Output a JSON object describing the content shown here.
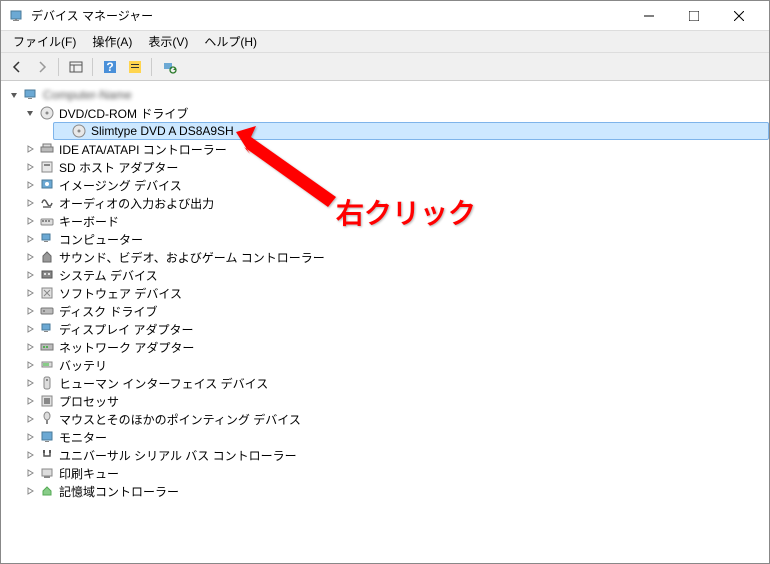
{
  "window": {
    "title": "デバイス マネージャー"
  },
  "menubar": {
    "file": "ファイル(F)",
    "action": "操作(A)",
    "view": "表示(V)",
    "help": "ヘルプ(H)"
  },
  "tree": {
    "root": "Computer-Name",
    "dvd_category": "DVD/CD-ROM ドライブ",
    "dvd_device": "Slimtype DVD A  DS8A9SH",
    "items": [
      "IDE ATA/ATAPI コントローラー",
      "SD ホスト アダプター",
      "イメージング デバイス",
      "オーディオの入力および出力",
      "キーボード",
      "コンピューター",
      "サウンド、ビデオ、およびゲーム コントローラー",
      "システム デバイス",
      "ソフトウェア デバイス",
      "ディスク ドライブ",
      "ディスプレイ アダプター",
      "ネットワーク アダプター",
      "バッテリ",
      "ヒューマン インターフェイス デバイス",
      "プロセッサ",
      "マウスとそのほかのポインティング デバイス",
      "モニター",
      "ユニバーサル シリアル バス コントローラー",
      "印刷キュー",
      "記憶域コントローラー"
    ]
  },
  "annotation": {
    "text": "右クリック"
  }
}
